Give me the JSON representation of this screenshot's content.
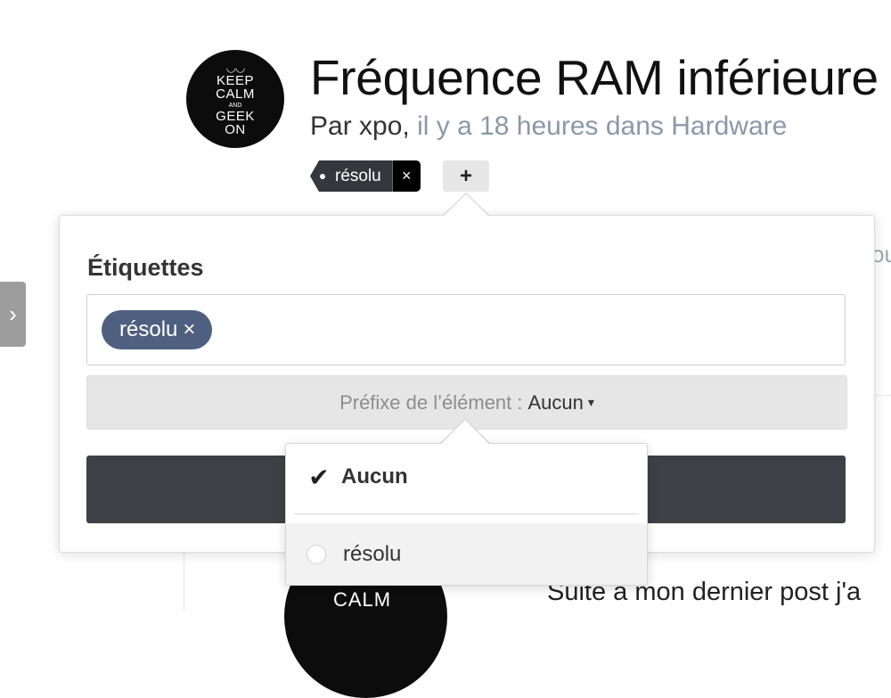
{
  "topic": {
    "avatar_text": [
      "KEEP",
      "CALM",
      "AND",
      "GEEK",
      "ON"
    ],
    "title": "Fréquence RAM inférieure",
    "byline_prefix": "Par xpo,",
    "byline_meta": "il y a 18 heures dans Hardware",
    "tag_label": "résolu",
    "tag_remove": "×",
    "add_tag": "+"
  },
  "side_toggle": "›",
  "background": {
    "fragment_ou": "ou",
    "avatar2_text": "CALM",
    "post_excerpt": "Suite à mon dernier post j'a"
  },
  "tags_popover": {
    "heading": "Étiquettes",
    "tokens": [
      {
        "label": "résolu",
        "remove": "×"
      }
    ],
    "prefix_label": "Préfixe de l’élément :",
    "prefix_value": "Aucun",
    "prefix_caret": "▾"
  },
  "prefix_dropdown": {
    "items": [
      {
        "label": "Aucun",
        "selected": true,
        "icon": "check-icon"
      },
      {
        "label": "résolu",
        "selected": false,
        "icon": "radio-icon"
      }
    ]
  },
  "colors": {
    "token_bg": "#4e5f80",
    "submit_bg": "#3e4046",
    "tag_chip_bg": "#34373d",
    "byline_muted": "#8a98a8"
  }
}
